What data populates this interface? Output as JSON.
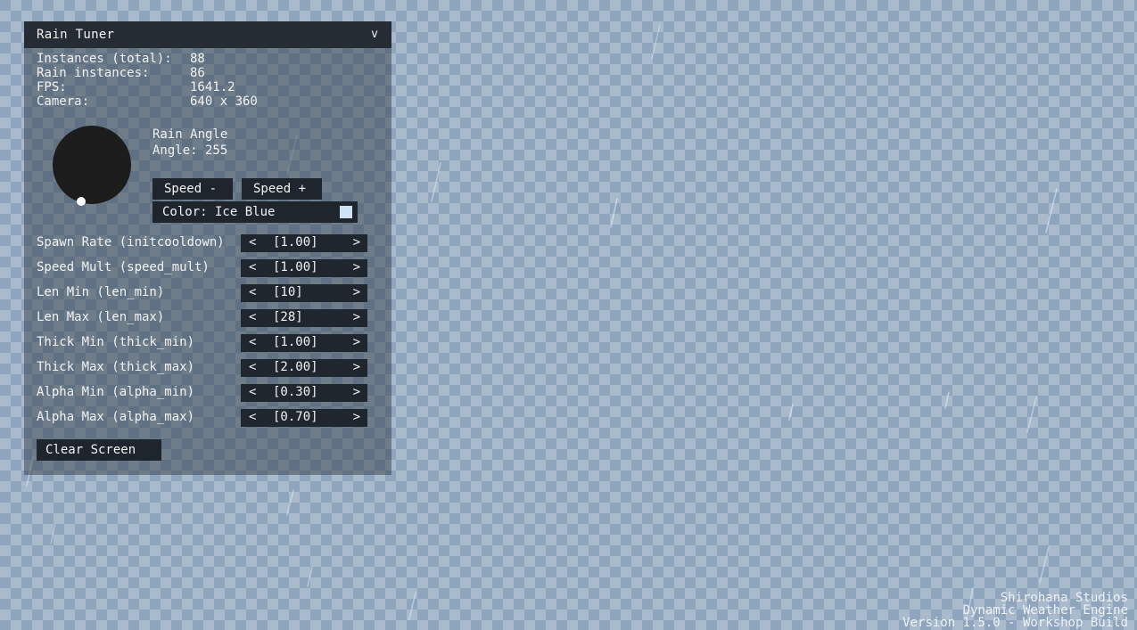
{
  "window": {
    "title": "Rain Tuner",
    "collapse_label": "v"
  },
  "stats": [
    {
      "label": "Instances (total):",
      "value": "88"
    },
    {
      "label": "Rain instances:",
      "value": "86"
    },
    {
      "label": "FPS:",
      "value": "1641.2"
    },
    {
      "label": "Camera:",
      "value": "640 x 360"
    }
  ],
  "angle": {
    "heading": "Rain Angle",
    "value_text": "Angle: 255"
  },
  "buttons": {
    "speed_minus": "Speed -",
    "speed_plus": "Speed +",
    "color": "Color: Ice Blue",
    "clear": "Clear Screen"
  },
  "colors": {
    "ice_blue_swatch": "#cfe2f6",
    "panel_bar": "#262c34",
    "dial": "#1c1c1c"
  },
  "params": [
    {
      "label": "Spawn Rate (initcooldown)",
      "value": "[1.00]",
      "dec": "<",
      "inc": ">"
    },
    {
      "label": "Speed Mult (speed_mult)",
      "value": "[1.00]",
      "dec": "<",
      "inc": ">"
    },
    {
      "label": "Len Min (len_min)",
      "value": "[10]",
      "dec": "<",
      "inc": ">"
    },
    {
      "label": "Len Max (len_max)",
      "value": "[28]",
      "dec": "<",
      "inc": ">"
    },
    {
      "label": "Thick Min (thick_min)",
      "value": "[1.00]",
      "dec": "<",
      "inc": ">"
    },
    {
      "label": "Thick Max (thick_max)",
      "value": "[2.00]",
      "dec": "<",
      "inc": ">"
    },
    {
      "label": "Alpha Min (alpha_min)",
      "value": "[0.30]",
      "dec": "<",
      "inc": ">"
    },
    {
      "label": "Alpha Max (alpha_max)",
      "value": "[0.70]",
      "dec": "<",
      "inc": ">"
    }
  ],
  "credits": [
    "Shirohana Studios",
    "Dynamic Weather Engine",
    "Version 1.5.0 - Workshop Build"
  ]
}
